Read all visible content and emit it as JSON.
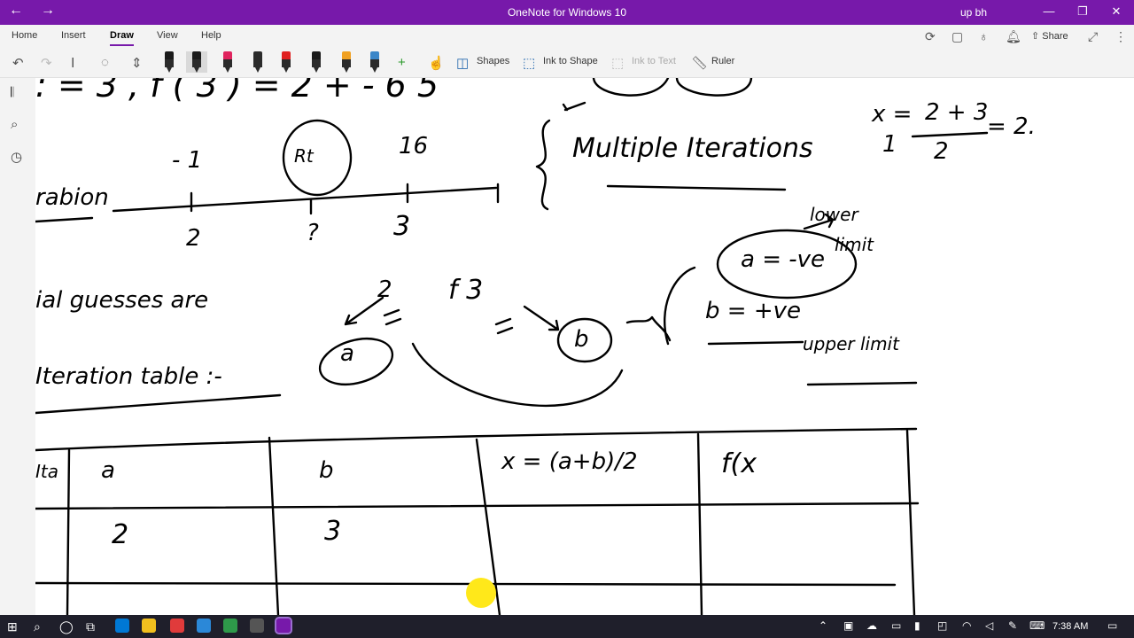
{
  "titlebar": {
    "title": "OneNote for Windows 10",
    "user": "up bh",
    "back_glyph": "←",
    "forward_glyph": "→",
    "minimize_glyph": "—",
    "restore_glyph": "❐",
    "close_glyph": "✕"
  },
  "ribbon_tabs": [
    "Home",
    "Insert",
    "Draw",
    "View",
    "Help"
  ],
  "active_tab": "Draw",
  "ribbon_right": {
    "share_label": "Share"
  },
  "draw_toolbar": {
    "shapes_label": "Shapes",
    "ink_to_shape_label": "Ink to Shape",
    "ink_to_text_label": "Ink to Text",
    "ruler_label": "Ruler",
    "pen_colors": [
      "#1a1a1a",
      "#1a1a1a",
      "#e0245e",
      "#2b2b2b",
      "#e02020",
      "#1a1a1a",
      "#f0a020",
      "#3a86c8"
    ]
  },
  "page": {
    "top_line": ": = 3 , f ( 3 ) = 2 + - 6   5",
    "value_neg": "- 1",
    "value_16": "16",
    "root_label": "Rt",
    "partial_word": "rabion",
    "number_2": "2",
    "question": "?",
    "number_3": "3",
    "multiple": "Multiple Iterations",
    "formula_x": "x =",
    "formula_top": "2 + 3",
    "formula_bottom": "2",
    "formula_result": "= 2.",
    "formula_one": "1",
    "lower_word": "lower",
    "limit_word": "limit",
    "a_neg": "a = -ve",
    "b_pos": "b = +ve",
    "upper_limit": "upper limit",
    "guesses": "ial  guesses  are",
    "guess_2": "2",
    "guess_f3": "f 3",
    "label_a": "a",
    "label_b": "b",
    "iteration_table": "Iteration  table :-",
    "table_headers": [
      "Ita",
      "a",
      "b",
      "x = (a+b)/2",
      "f(x"
    ],
    "table_row_1": [
      "",
      "2",
      "3",
      "",
      ""
    ]
  },
  "taskbar": {
    "clock": "7:38 AM",
    "start_glyph": "⊞",
    "search_glyph": "⌕"
  },
  "colors": {
    "titlebar": "#7719aa",
    "ribbon": "#f3f3f3",
    "taskbar": "#1f1f2b",
    "highlight_dot": "#ffe81a"
  }
}
